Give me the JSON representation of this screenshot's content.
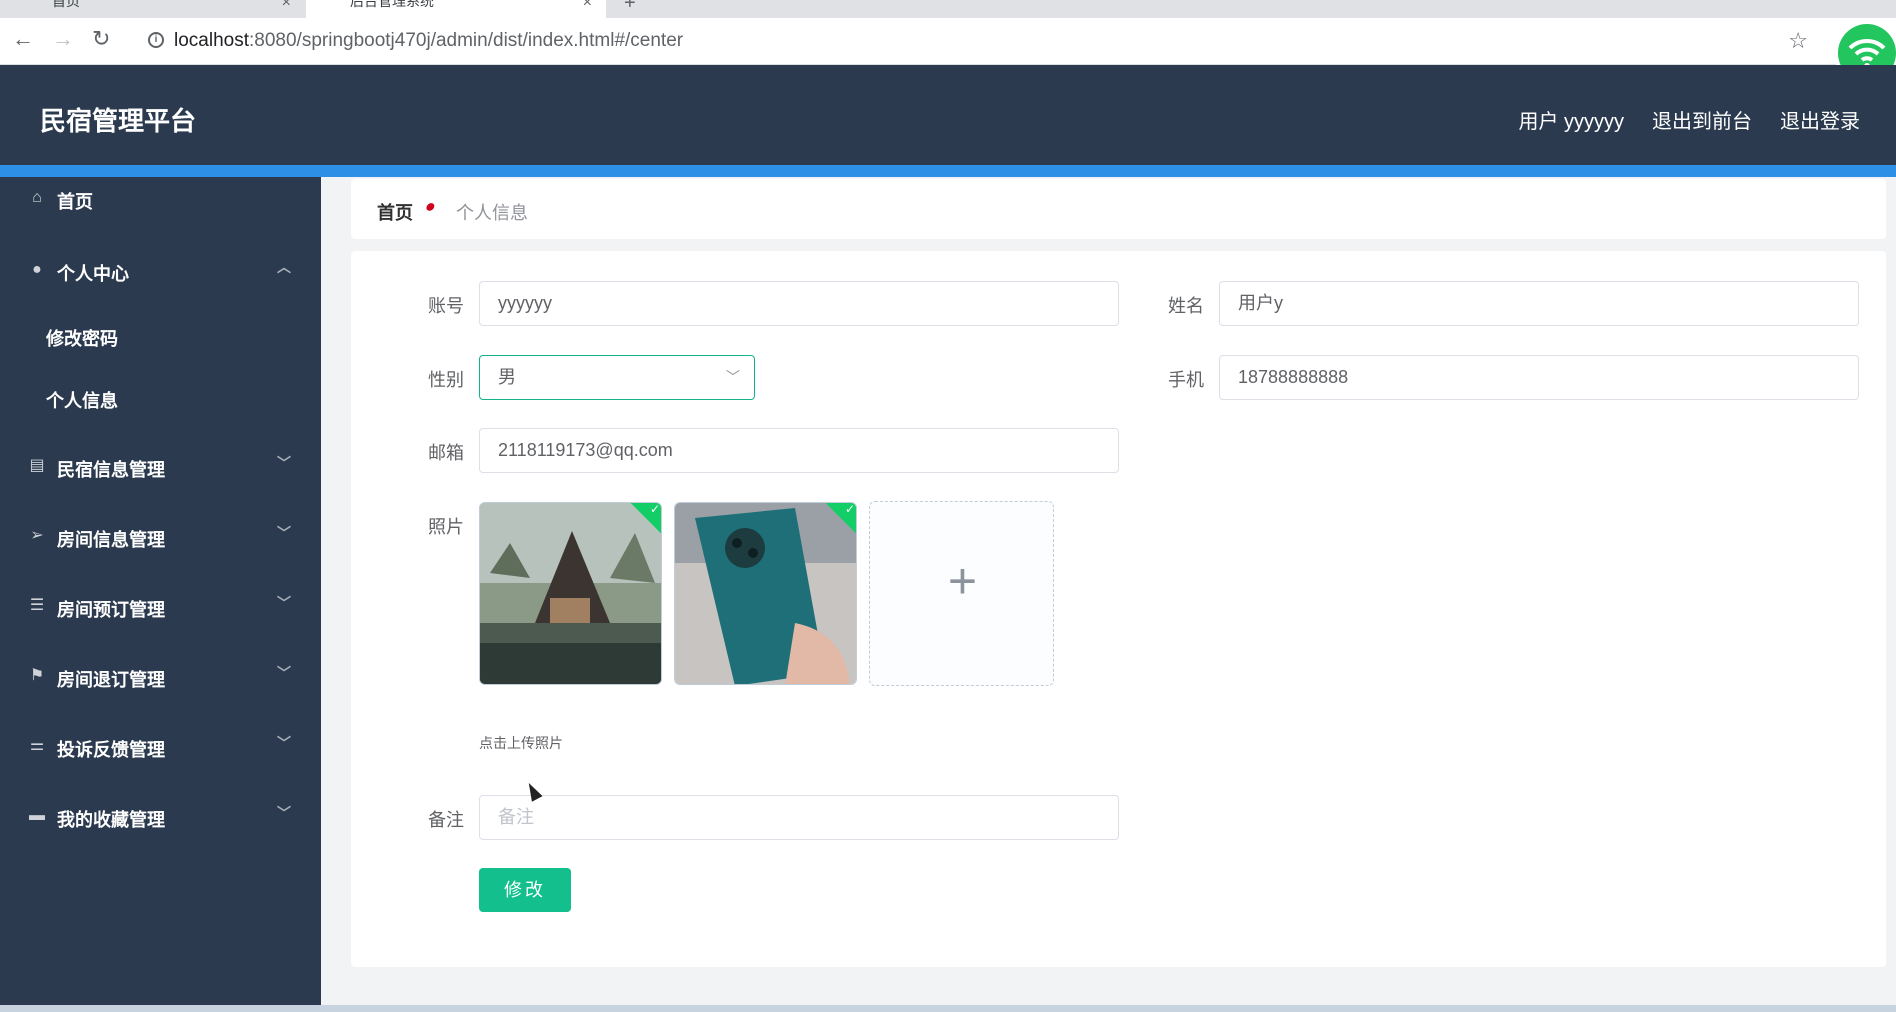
{
  "browser": {
    "tabs": [
      {
        "label": "首页"
      },
      {
        "label": "后台管理系统"
      }
    ],
    "url_host": "localhost",
    "url_path": ":8080/springbootj470j/admin/dist/index.html#/center",
    "new_tab": "+"
  },
  "header": {
    "brand": "民宿管理平台",
    "user": "用户 yyyyyy",
    "to_front": "退出到前台",
    "logout": "退出登录"
  },
  "sidebar": {
    "items": [
      {
        "label": "首页",
        "icon": "home-icon"
      },
      {
        "label": "个人中心",
        "icon": "user-icon"
      },
      {
        "label": "修改密码"
      },
      {
        "label": "个人信息"
      },
      {
        "label": "民宿信息管理",
        "icon": "clipboard-icon"
      },
      {
        "label": "房间信息管理",
        "icon": "send-icon"
      },
      {
        "label": "房间预订管理",
        "icon": "list-icon"
      },
      {
        "label": "房间退订管理",
        "icon": "flag-icon"
      },
      {
        "label": "投诉反馈管理",
        "icon": "sliders-icon"
      },
      {
        "label": "我的收藏管理",
        "icon": "monitor-icon"
      }
    ]
  },
  "breadcrumb": {
    "home": "首页",
    "current": "个人信息"
  },
  "form": {
    "account_label": "账号",
    "account_value": "yyyyyy",
    "name_label": "姓名",
    "name_value": "用户y",
    "gender_label": "性别",
    "gender_value": "男",
    "phone_label": "手机",
    "phone_value": "18788888888",
    "email_label": "邮箱",
    "email_value": "2118119173@qq.com",
    "photo_label": "照片",
    "photo_hint": "点击上传照片",
    "remark_label": "备注",
    "remark_placeholder": "备注",
    "submit": "修改"
  }
}
